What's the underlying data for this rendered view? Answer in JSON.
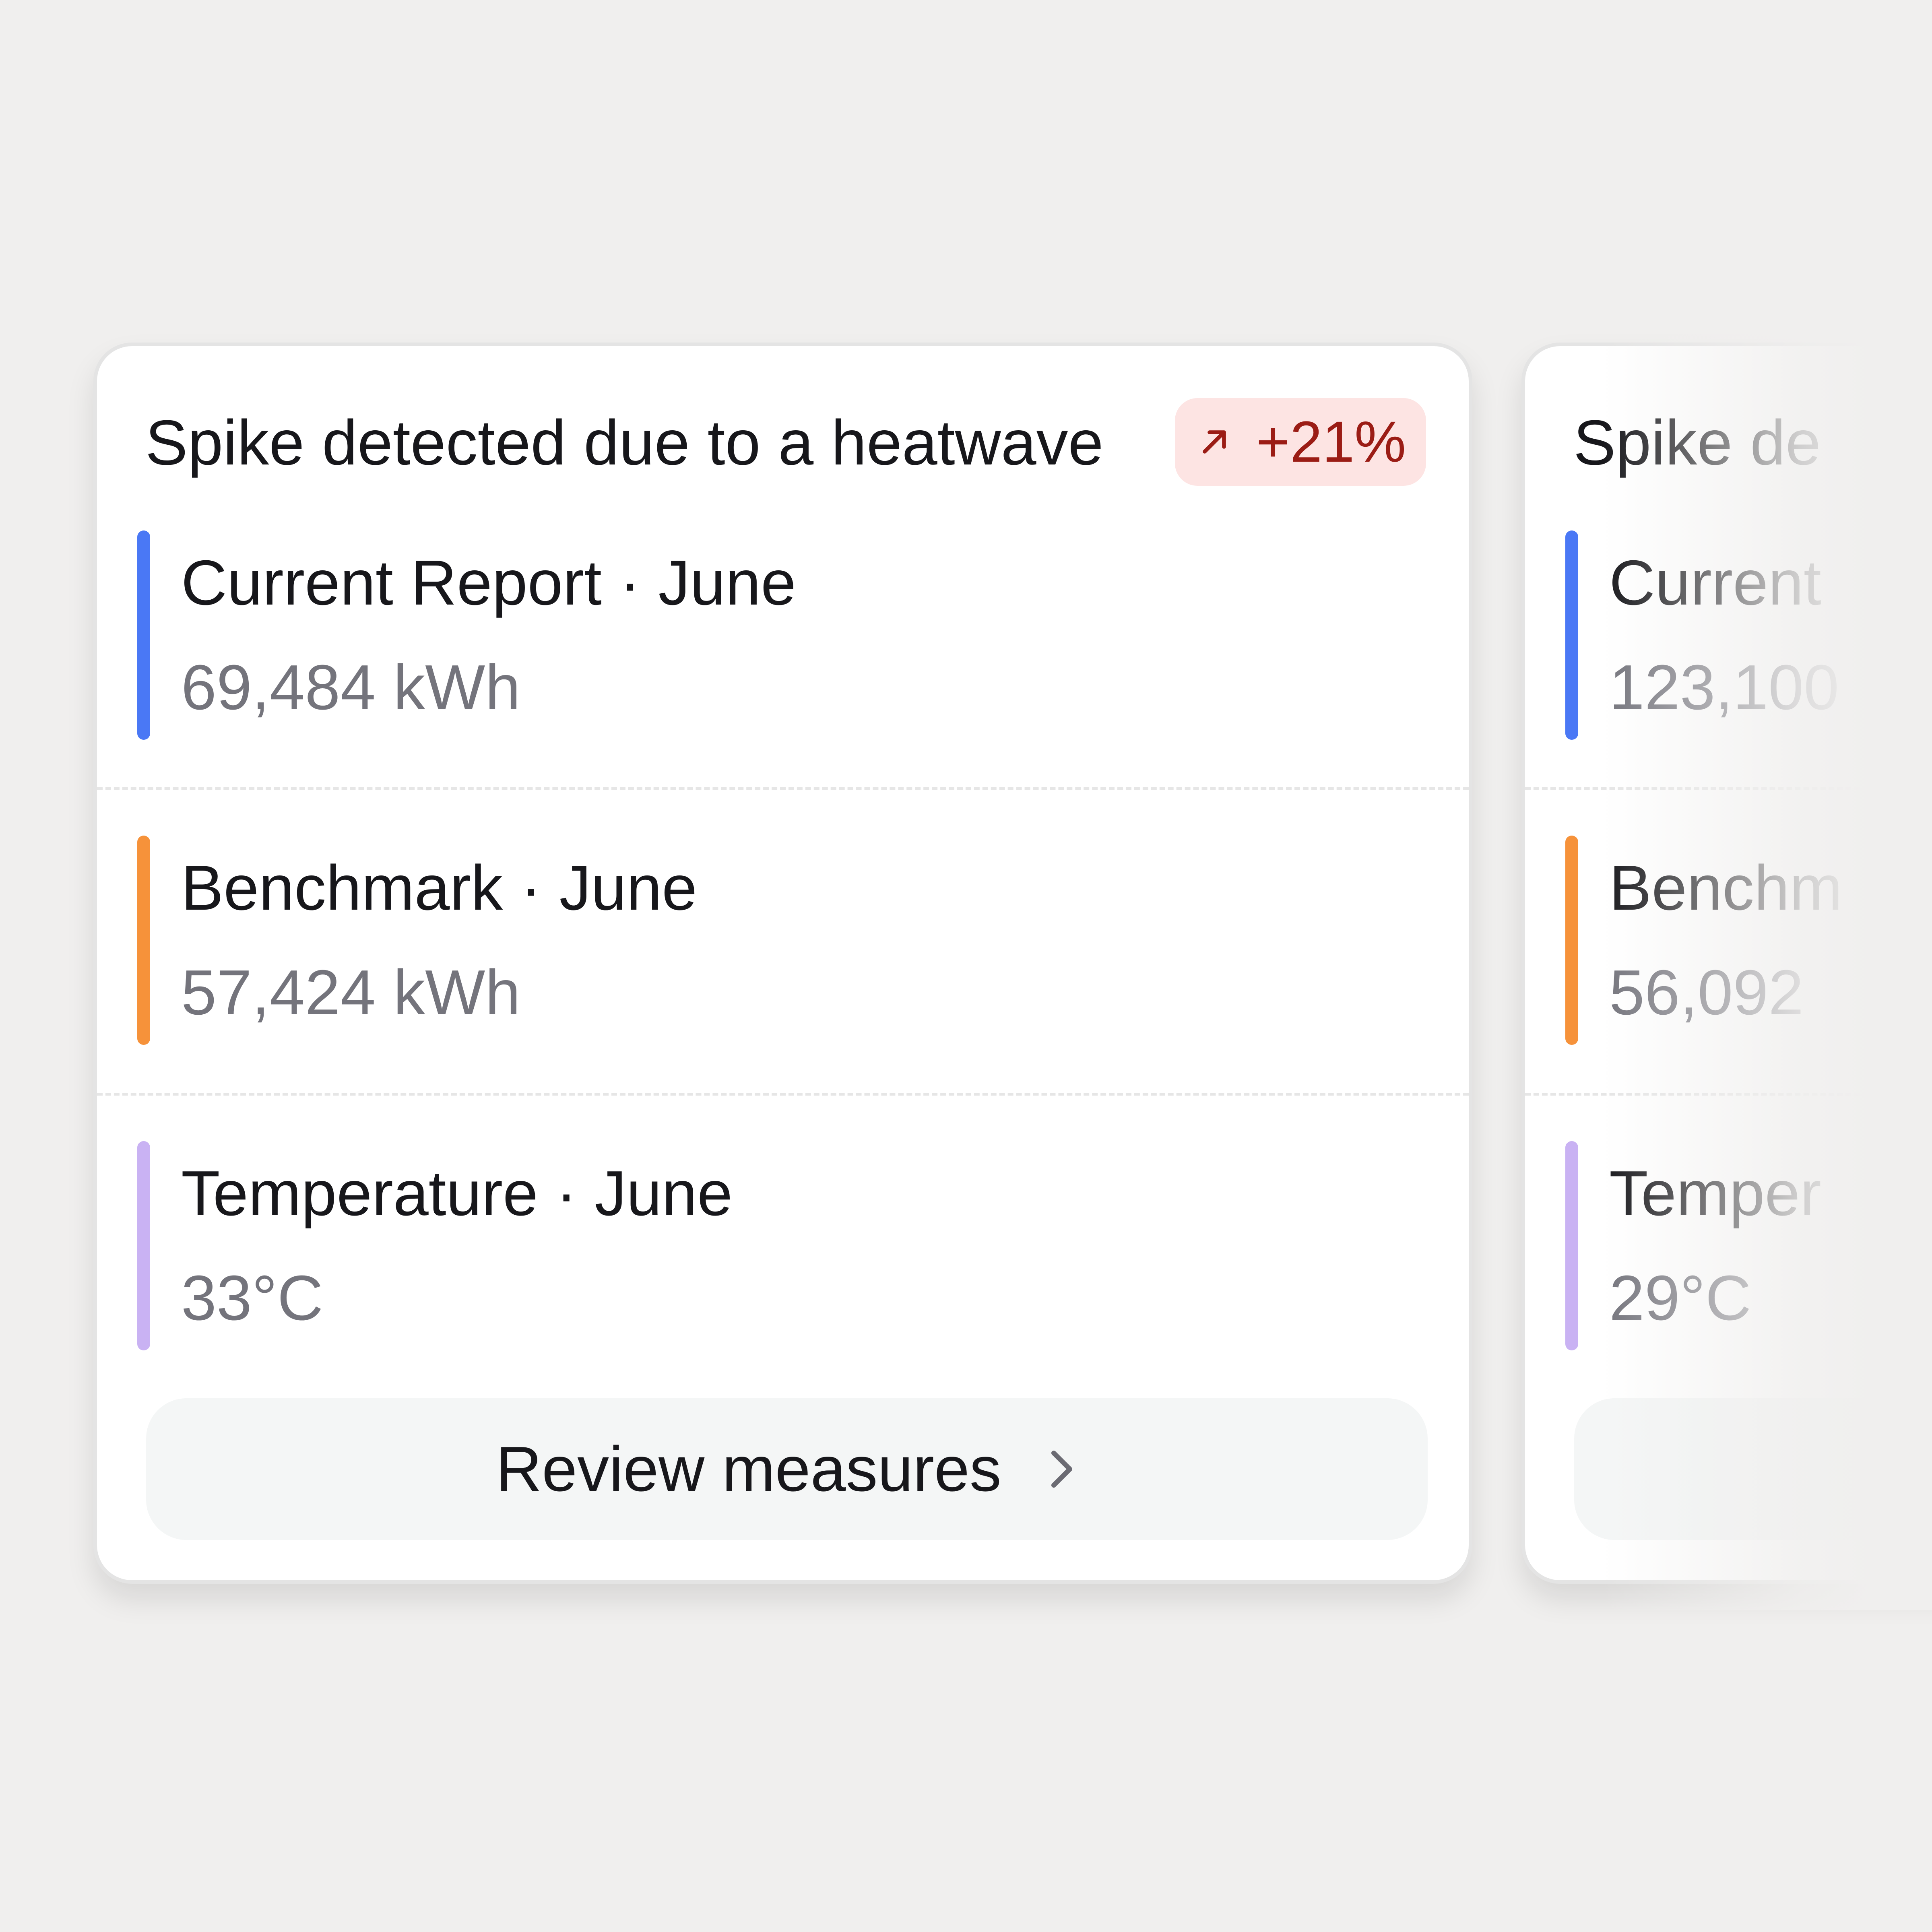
{
  "colors": {
    "background": "#f0efee",
    "card": "#ffffff",
    "badge_bg": "#fde4e3",
    "badge_text": "#9b1c15",
    "series_current": "#4a78f5",
    "series_benchmark": "#f6923a",
    "series_temperature": "#c9b2f3",
    "text_primary": "#17171b",
    "text_secondary": "#74747c"
  },
  "cards": [
    {
      "title": "Spike detected due to a heatwave",
      "badge": {
        "icon": "arrow-up-right-icon",
        "text": "+21%"
      },
      "metrics": [
        {
          "label": "Current Report · June",
          "value": "69,484 kWh",
          "color": "#4a78f5"
        },
        {
          "label": "Benchmark · June",
          "value": "57,424 kWh",
          "color": "#f6923a"
        },
        {
          "label": "Temperature · June",
          "value": "33°C",
          "color": "#c9b2f3"
        }
      ],
      "action": {
        "label": "Review measures",
        "icon": "chevron-right-icon"
      }
    },
    {
      "title": "Spike de",
      "metrics": [
        {
          "label": "Current",
          "value": "123,100",
          "color": "#4a78f5"
        },
        {
          "label": "Benchm",
          "value": "56,092",
          "color": "#f6923a"
        },
        {
          "label": "Temper",
          "value": "29°C",
          "color": "#c9b2f3"
        }
      ]
    }
  ]
}
